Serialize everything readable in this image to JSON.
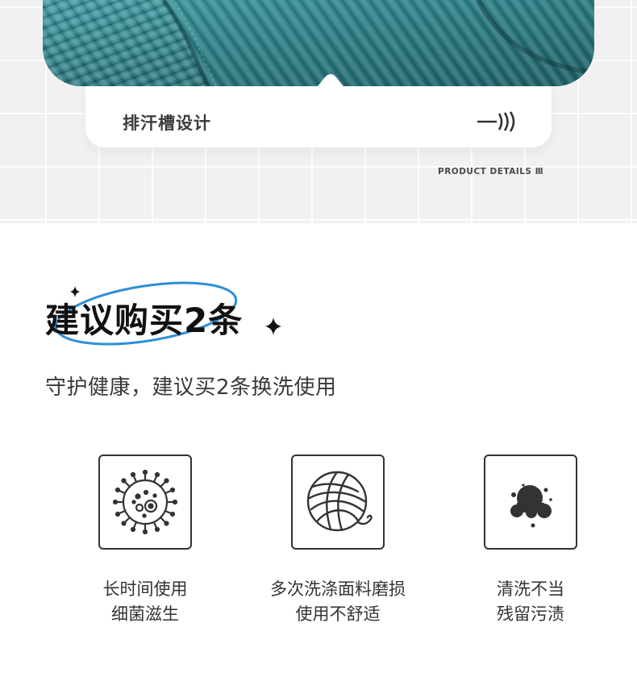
{
  "product_detail": {
    "caption": "排汗槽设计",
    "details_label": "PRODUCT DETAILS Ⅲ"
  },
  "recommendation": {
    "title": "建议购买2条",
    "subtitle": "守护健康，建议买2条换洗使用"
  },
  "features": [
    {
      "icon": "bacteria-icon",
      "line1": "长时间使用",
      "line2": "细菌滋生"
    },
    {
      "icon": "yarn-ball-icon",
      "line1": "多次洗涤面料磨损",
      "line2": "使用不舒适"
    },
    {
      "icon": "stain-icon",
      "line1": "清洗不当",
      "line2": "残留污渍"
    }
  ],
  "colors": {
    "fabric": "#2f7f86",
    "accent_ring": "#2d8fd6",
    "text_dark": "#111111"
  }
}
